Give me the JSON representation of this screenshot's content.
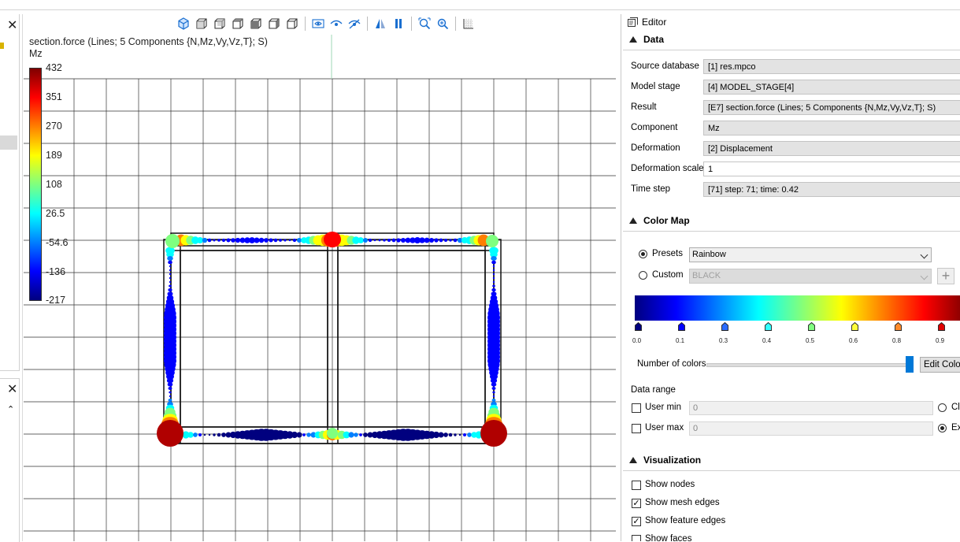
{
  "viewport": {
    "title": "section.force (Lines; 5 Components {N,Mz,Vy,Vz,T}; S)",
    "component": "Mz",
    "colorbar": {
      "labels": [
        "432",
        "351",
        "270",
        "189",
        "108",
        "26.5",
        "-54.6",
        "-136",
        "-217"
      ]
    }
  },
  "editor": {
    "title": "Editor",
    "data_section": "Data",
    "props": [
      {
        "label": "Source database",
        "value": "[1] res.mpco"
      },
      {
        "label": "Model stage",
        "value": "[4] MODEL_STAGE[4]"
      },
      {
        "label": "Result",
        "value": "[E7] section.force (Lines; 5 Components {N,Mz,Vy,Vz,T}; S)"
      },
      {
        "label": "Component",
        "value": "Mz"
      },
      {
        "label": "Deformation",
        "value": "[2] Displacement"
      },
      {
        "label": "Deformation scale",
        "value": "1"
      },
      {
        "label": "Time step",
        "value": "[71] step: 71; time: 0.42"
      }
    ],
    "colormap_section": "Color Map",
    "presets_label": "Presets",
    "presets_value": "Rainbow",
    "custom_label": "Custom",
    "custom_value": "BLACK",
    "stops": [
      "0.0",
      "0.1",
      "0.3",
      "0.4",
      "0.5",
      "0.6",
      "0.8",
      "0.9"
    ],
    "stop_colors": [
      "#00007f",
      "#0000ff",
      "#2b6cff",
      "#31ffff",
      "#7fff7f",
      "#ffff3a",
      "#ff8a2a",
      "#e00000"
    ],
    "num_colors_label": "Number of colors",
    "edit_color_label": "Edit Color",
    "data_range_label": "Data range",
    "user_min_label": "User min",
    "user_min_value": "0",
    "user_max_label": "User max",
    "user_max_value": "0",
    "clip_label": "Cl",
    "extend_label": "Ex",
    "visualization_section": "Visualization",
    "show_nodes": "Show nodes",
    "show_mesh_edges": "Show mesh edges",
    "show_feature_edges": "Show feature edges",
    "show_faces": "Show faces"
  }
}
